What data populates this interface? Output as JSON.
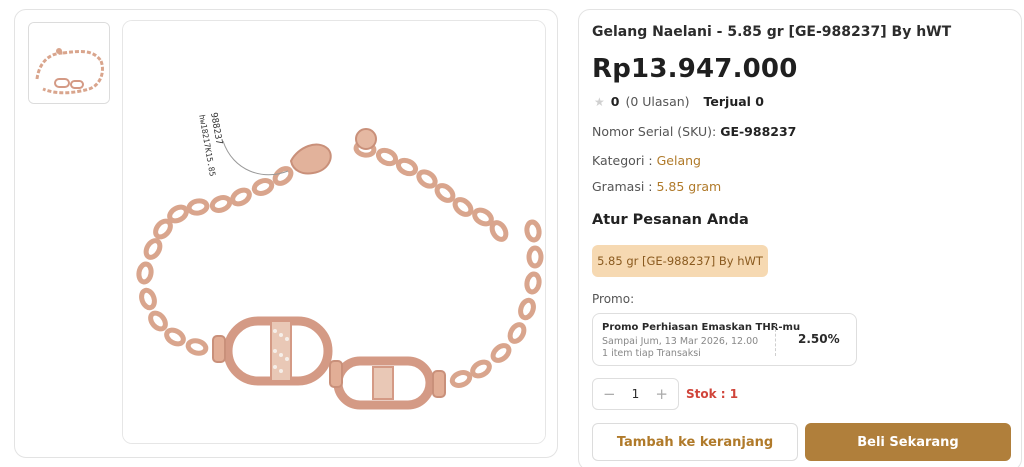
{
  "product": {
    "title": "Gelang Naelani - 5.85 gr [GE-988237] By hWT",
    "price": "Rp13.947.000",
    "rating_value": "0",
    "reviews": "(0 Ulasan)",
    "sold": "Terjual 0",
    "sku_label": "Nomor Serial (SKU):",
    "sku_value": "GE-988237",
    "category_label": "Kategori :",
    "category_value": "Gelang",
    "weight_label": "Gramasi :",
    "weight_value": "5.85 gram",
    "tag_text": "988237",
    "tag_code": "hw18217K15.85"
  },
  "order": {
    "section_title": "Atur Pesanan Anda",
    "variant": "5.85 gr [GE-988237] By hWT",
    "promo_label": "Promo:",
    "promo_name": "Promo Perhiasan Emaskan THR-mu",
    "promo_until": "Sampai Jum, 13 Mar 2026, 12.00",
    "promo_limit": "1 item tiap Transaksi",
    "promo_percent": "2.50%",
    "quantity": "1",
    "stock": "Stok : 1"
  },
  "actions": {
    "add_to_cart": "Tambah ke keranjang",
    "buy_now": "Beli Sekarang"
  },
  "colors": {
    "accent": "#b07f3b",
    "variant_bg": "#f6d9b2",
    "stock": "#d0443a",
    "gold": "#d9a58d"
  }
}
